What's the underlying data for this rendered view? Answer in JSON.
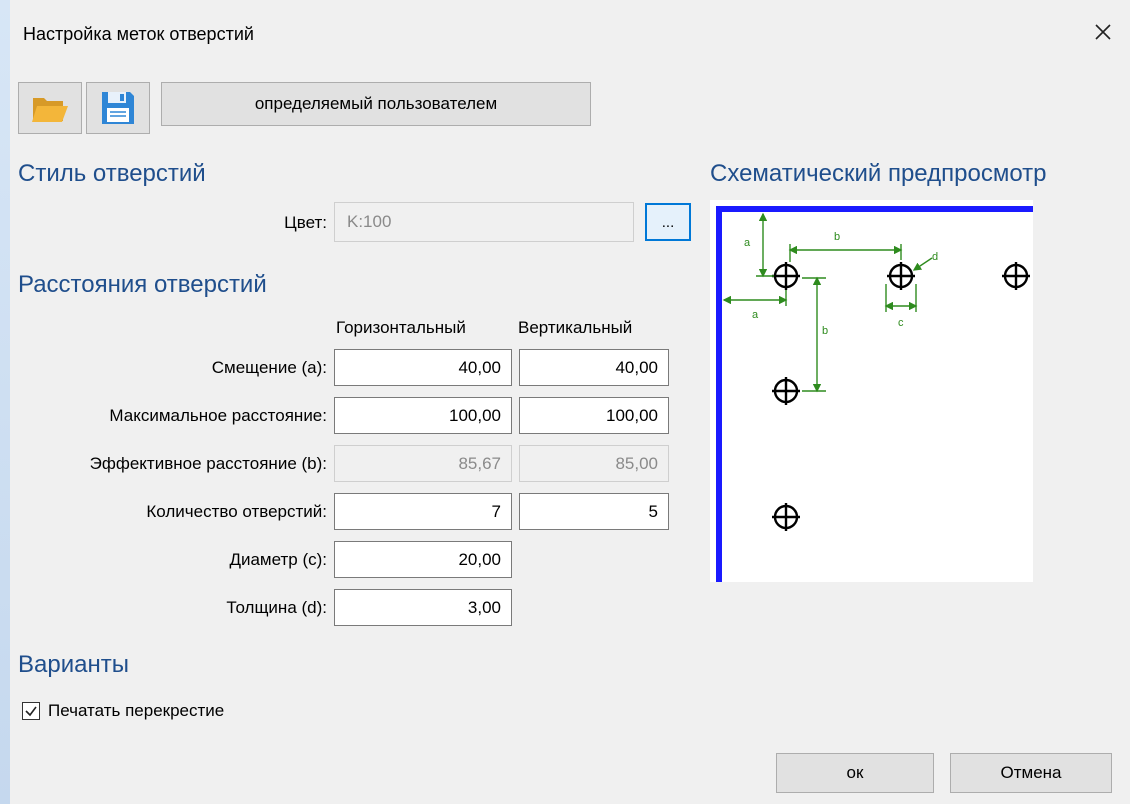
{
  "dialog": {
    "title": "Настройка меток отверстий"
  },
  "toolbar": {
    "open_icon": "folder-open-icon",
    "save_icon": "floppy-save-icon",
    "preset_label": "определяемый пользователем"
  },
  "style_section": {
    "heading": "Стиль отверстий",
    "color_label": "Цвет:",
    "color_value": "K:100",
    "browse_label": "...",
    "accent": "#0078d7"
  },
  "distance_section": {
    "heading": "Расстояния отверстий",
    "col_horizontal": "Горизонтальный",
    "col_vertical": "Вертикальный",
    "rows": [
      {
        "label": "Смещение (a):",
        "h": "40,00",
        "v": "40,00"
      },
      {
        "label": "Максимальное расстояние:",
        "h": "100,00",
        "v": "100,00"
      },
      {
        "label": "Эффективное расстояние (b):",
        "h": "85,67",
        "v": "85,00"
      },
      {
        "label": "Количество отверстий:",
        "h": "7",
        "v": "5"
      },
      {
        "label": "Диаметр (c):",
        "h": "20,00"
      },
      {
        "label": "Толщина (d):",
        "h": "3,00"
      }
    ]
  },
  "preview": {
    "heading": "Схематический предпросмотр",
    "labels": {
      "a_top": "a",
      "a_left": "a",
      "b_h": "b",
      "b_v": "b",
      "c": "c",
      "d": "d"
    },
    "colors": {
      "border": "#1a1aff",
      "dimension": "#2e8b1e"
    }
  },
  "options": {
    "heading": "Варианты",
    "print_crosshair_label": "Печатать перекрестие",
    "print_crosshair_checked": true
  },
  "buttons": {
    "ok": "ок",
    "cancel": "Отмена"
  }
}
